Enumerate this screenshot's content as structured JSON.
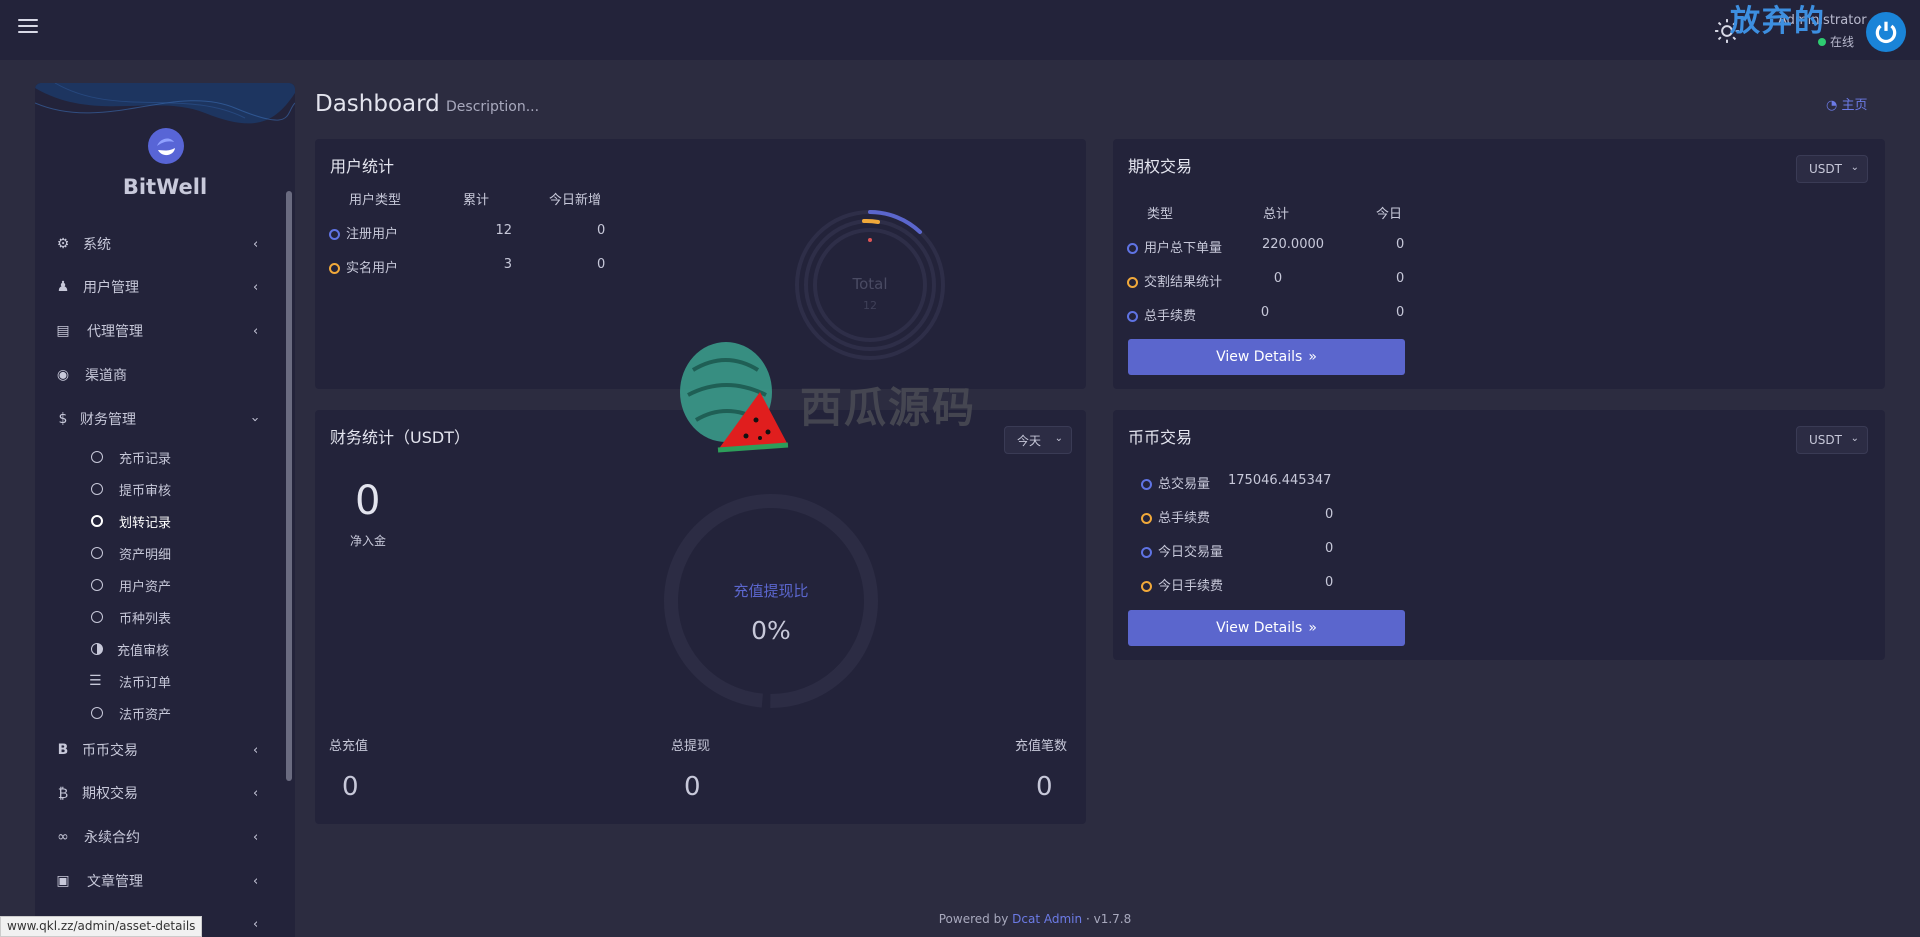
{
  "topbar": {
    "watermark": "放弃的",
    "user_name": "Administrator",
    "user_status": "在线"
  },
  "sidebar": {
    "logo_text": "BitWell",
    "items": [
      {
        "label": "系统",
        "icon": "gear-icon"
      },
      {
        "label": "用户管理",
        "icon": "user-icon"
      },
      {
        "label": "代理管理",
        "icon": "id-card-icon"
      },
      {
        "label": "渠道商",
        "icon": "user-circle-icon"
      },
      {
        "label": "财务管理",
        "icon": "dollar-icon"
      }
    ],
    "sub_items": [
      {
        "label": "充币记录"
      },
      {
        "label": "提币审核"
      },
      {
        "label": "划转记录"
      },
      {
        "label": "资产明细"
      },
      {
        "label": "用户资产"
      },
      {
        "label": "币种列表"
      },
      {
        "label": "充值审核"
      },
      {
        "label": "法币订单"
      },
      {
        "label": "法币资产"
      }
    ],
    "items_after": [
      {
        "label": "币币交易",
        "icon": "b-icon"
      },
      {
        "label": "期权交易",
        "icon": "bitcoin-icon"
      },
      {
        "label": "永续合约",
        "icon": "link-icon"
      },
      {
        "label": "文章管理",
        "icon": "newspaper-icon"
      }
    ]
  },
  "header": {
    "title": "Dashboard",
    "description": "Description...",
    "home_link": "主页"
  },
  "user_stats": {
    "title": "用户统计",
    "columns": [
      "用户类型",
      "累计",
      "今日新增"
    ],
    "rows": [
      {
        "type": "注册用户",
        "total": "12",
        "today": "0",
        "dot": "blue"
      },
      {
        "type": "实名用户",
        "total": "3",
        "today": "0",
        "dot": "orange"
      }
    ],
    "chart_center_label": "Total",
    "chart_center_value": "12"
  },
  "options_trade": {
    "title": "期权交易",
    "select": "USDT",
    "columns": [
      "类型",
      "总计",
      "今日"
    ],
    "rows": [
      {
        "type": "用户总下单量",
        "total": "220.0000",
        "today": "0",
        "dot": "blue"
      },
      {
        "type": "交割结果统计",
        "total": "0",
        "today": "0",
        "dot": "orange"
      },
      {
        "type": "总手续费",
        "total": "0",
        "today": "0",
        "dot": "blue"
      }
    ],
    "button": "View Details"
  },
  "finance": {
    "title": "财务统计（USDT）",
    "select": "今天",
    "net_value": "0",
    "net_label": "净入金",
    "ring_label": "充值提现比",
    "ring_value": "0%",
    "stats": [
      {
        "label": "总充值",
        "value": "0"
      },
      {
        "label": "总提现",
        "value": "0"
      },
      {
        "label": "充值笔数",
        "value": "0"
      }
    ]
  },
  "spot_trade": {
    "title": "币币交易",
    "select": "USDT",
    "rows": [
      {
        "label": "总交易量",
        "value": "175046.445347",
        "dot": "blue"
      },
      {
        "label": "总手续费",
        "value": "0",
        "dot": "orange"
      },
      {
        "label": "今日交易量",
        "value": "0",
        "dot": "blue"
      },
      {
        "label": "今日手续费",
        "value": "0",
        "dot": "orange"
      }
    ],
    "button": "View Details"
  },
  "watermark_center": "西瓜源码",
  "footer": {
    "powered_by": "Powered by",
    "link": "Dcat Admin",
    "sep": "·",
    "version": "v1.7.8"
  },
  "status_url": "www.qkl.zz/admin/asset-details",
  "colors": {
    "accent": "#5b66cd",
    "dot_blue": "#5f73e3",
    "dot_orange": "#f1a93a",
    "online": "#2ecc71"
  }
}
